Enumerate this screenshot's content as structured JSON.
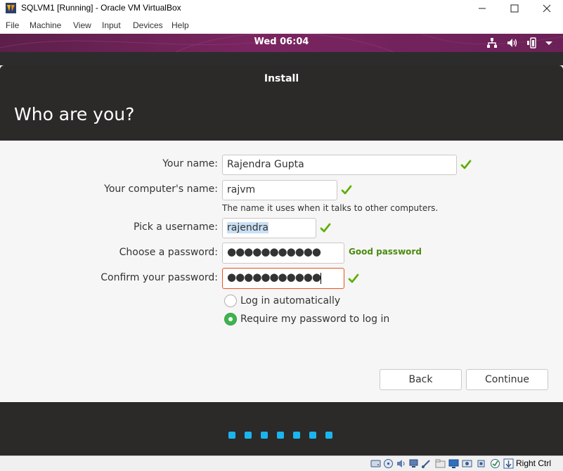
{
  "window": {
    "title": "SQLVM1 [Running] - Oracle VM VirtualBox",
    "menu": [
      "File",
      "Machine",
      "View",
      "Input",
      "Devices",
      "Help"
    ]
  },
  "guest": {
    "clock": "Wed 06:04",
    "installer": {
      "title": "Install",
      "heading": "Who are you?",
      "fields": {
        "name": {
          "label": "Your name:",
          "value": "Rajendra Gupta"
        },
        "computer": {
          "label": "Your computer's name:",
          "value": "rajvm",
          "hint": "The name it uses when it talks to other computers."
        },
        "username": {
          "label": "Pick a username:",
          "value": "rajendra"
        },
        "password": {
          "label": "Choose a password:",
          "masked": "●●●●●●●●●●●",
          "strength": "Good password"
        },
        "confirm": {
          "label": "Confirm your password:",
          "masked": "●●●●●●●●●●●"
        }
      },
      "login_options": [
        {
          "label": "Log in automatically",
          "selected": false
        },
        {
          "label": "Require my password to log in",
          "selected": true
        }
      ],
      "buttons": {
        "back": "Back",
        "continue": "Continue"
      },
      "progress_dots": 7
    }
  },
  "statusbar": {
    "host_key": "Right Ctrl",
    "icons": [
      "hard-disk-icon",
      "optical-drive-icon",
      "audio-icon",
      "network-icon",
      "usb-icon",
      "shared-folders-icon",
      "display-icon",
      "video-capture-icon",
      "cpu-icon",
      "virtualization-icon",
      "mouse-integration-icon"
    ]
  },
  "colors": {
    "accent": "#e95420",
    "topbar": "#6b2157",
    "installer_dark": "#2c2929",
    "check_green": "#73c216",
    "progress_dot": "#19b6ee",
    "strength_green": "#4b8a10"
  }
}
